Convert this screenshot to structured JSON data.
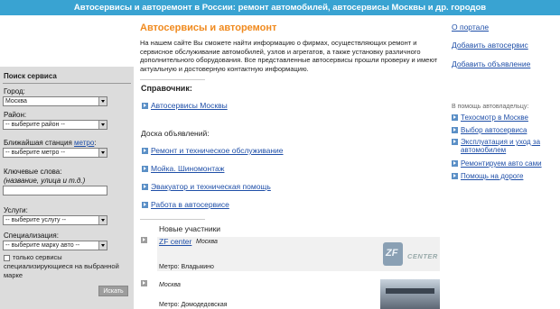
{
  "header": {
    "title": "Автосервисы и авторемонт в России: ремонт автомобилей, автосервисы Москвы и др. городов"
  },
  "sidebar": {
    "title": "Поиск сервиса",
    "city_label": "Город:",
    "city_value": "Москва",
    "district_label": "Район:",
    "district_value": "-- выберите район --",
    "station_label": "Ближайшая станция",
    "station_link": "метро",
    "station_colon": ":",
    "station_value": "-- выберите метро --",
    "keywords_label": "Ключевые слова:",
    "keywords_hint": "(название, улица и т.д.)",
    "keywords_value": "",
    "services_label": "Услуги:",
    "services_value": "-- выберите услугу --",
    "spec_label": "Специализация:",
    "spec_value": "-- выберите марку авто --",
    "checkbox_label": "только сервисы специализирующиеся на выбранной марке",
    "search_button": "Искать"
  },
  "main": {
    "title": "Автосервисы и авторемонт",
    "intro": "На нашем сайте Вы сможете найти информацию о фирмах, осуществляющих ремонт и сервисное обслуживание автомобилей, узлов и агрегатов, а также установку различного дополнительного оборудования. Все представленные автосервисы прошли проверку и имеют актуальную и достоверную контактную информацию.",
    "directory_heading": "Справочник:",
    "directory_link": "Автосервисы Москвы",
    "board_heading": "Доска объявлений:",
    "board_links": [
      "Ремонт и техническое обслуживание",
      "Мойка. Шиномонтаж",
      "Эвакуатор и техническая помощь",
      "Работа в автосервисе"
    ],
    "new_members_heading": "Новые участники",
    "members": [
      {
        "name": "ZF center",
        "city": "Москва",
        "metro": "Метро: Владыкино",
        "logo_text": "ZF",
        "logo_word": "CENTER"
      },
      {
        "name": "",
        "city": "Москва",
        "metro": "Метро: Домодедовская"
      }
    ]
  },
  "right": {
    "links": [
      "О портале",
      "Добавить автосервис",
      "Добавить объявление"
    ],
    "helper_heading": "В помощь автовладельцу:",
    "helper_links": [
      "Техосмотр в Москве",
      "Выбор автосервиса",
      "Эксплуатация и уход за автомобилем",
      "Ремонтируем авто сами",
      "Помощь на дороге"
    ]
  }
}
